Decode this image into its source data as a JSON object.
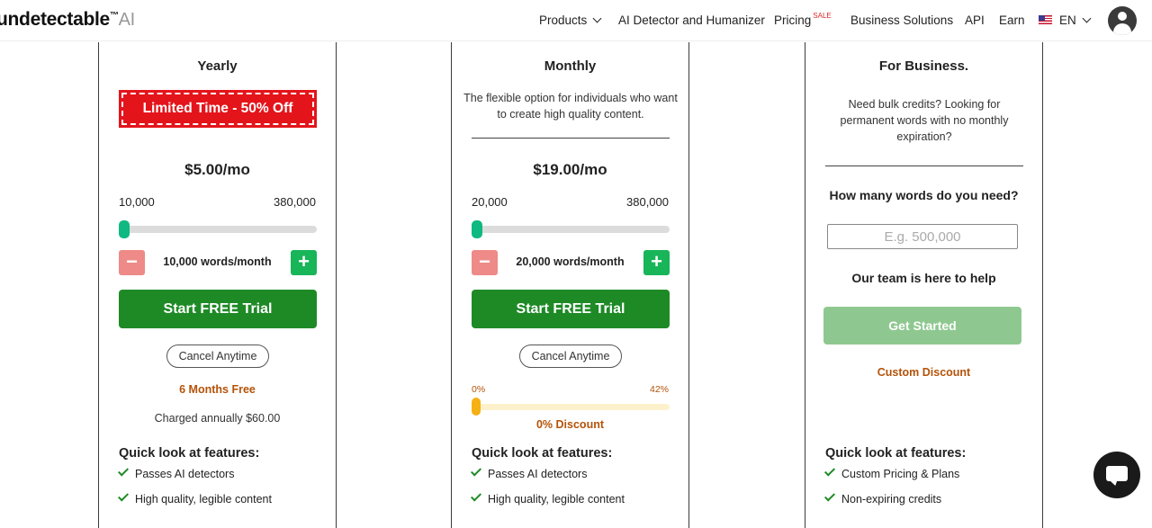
{
  "brand": {
    "name": "undetectable",
    "tm": "™",
    "ai": "AI"
  },
  "nav": {
    "products": "Products",
    "detector": "AI Detector and Humanizer",
    "pricing": "Pricing",
    "sale": "SALE",
    "business": "Business Solutions",
    "api": "API",
    "earn": "Earn",
    "lang": "EN"
  },
  "yearly": {
    "title": "Yearly",
    "badge": "Limited Time - 50% Off",
    "price": "$5.00/mo",
    "range_min": "10,000",
    "range_max": "380,000",
    "slider_fraction": 0,
    "minus": "−",
    "plus": "+",
    "words": "10,000 words/month",
    "cta": "Start FREE Trial",
    "cancel": "Cancel Anytime",
    "free": "6 Months Free",
    "charged": "Charged annually $60.00",
    "features_title": "Quick look at features:",
    "features": [
      "Passes AI detectors",
      "High quality, legible content"
    ]
  },
  "monthly": {
    "title": "Monthly",
    "desc": "The flexible option for individuals who want to create high quality content.",
    "price": "$19.00/mo",
    "range_min": "20,000",
    "range_max": "380,000",
    "slider_fraction": 0,
    "minus": "−",
    "plus": "+",
    "words": "20,000 words/month",
    "cta": "Start FREE Trial",
    "cancel": "Cancel Anytime",
    "discount_min": "0%",
    "discount_max": "42%",
    "discount_fraction": 0,
    "discount": "0% Discount",
    "features_title": "Quick look at features:",
    "features": [
      "Passes AI detectors",
      "High quality, legible content"
    ]
  },
  "business": {
    "title": "For Business.",
    "desc": "Need bulk credits? Looking for permanent words with no monthly expiration?",
    "question": "How many words do you need?",
    "placeholder": "E.g. 500,000",
    "help": "Our team is here to help",
    "cta": "Get Started",
    "custom": "Custom Discount",
    "features_title": "Quick look at features:",
    "features": [
      "Custom Pricing & Plans",
      "Non-expiring credits"
    ]
  },
  "colors": {
    "primary_green": "#1e8a26",
    "badge_red": "#e4141b",
    "accent_orange": "#b45309",
    "slider_green": "#10b981",
    "discount_yellow": "#f5b014"
  }
}
